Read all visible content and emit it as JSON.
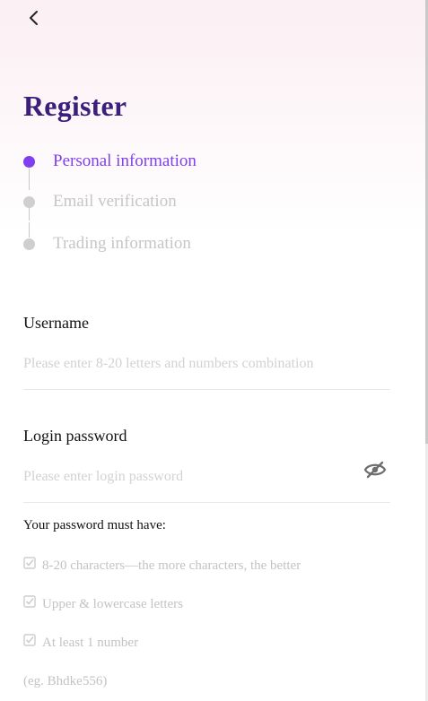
{
  "header": {
    "back_icon": "chevron-left-icon",
    "title": "Register"
  },
  "steps": [
    {
      "label": "Personal information",
      "active": true
    },
    {
      "label": "Email verification",
      "active": false
    },
    {
      "label": "Trading information",
      "active": false
    }
  ],
  "form": {
    "username": {
      "label": "Username",
      "value": "",
      "placeholder": "Please enter 8-20 letters and numbers combination"
    },
    "password": {
      "label": "Login password",
      "value": "",
      "placeholder": "Please enter login password",
      "toggle_icon": "eye-slash-icon"
    }
  },
  "password_rules": {
    "title": "Your password must have:",
    "items": [
      "8-20 characters—the more characters, the better",
      "Upper & lowercase letters",
      "At least 1 number"
    ],
    "example": "(eg. Bhdke556)"
  },
  "colors": {
    "accent": "#7f3ff0",
    "title": "#3b1f7a",
    "inactive": "#c6c6c6"
  }
}
